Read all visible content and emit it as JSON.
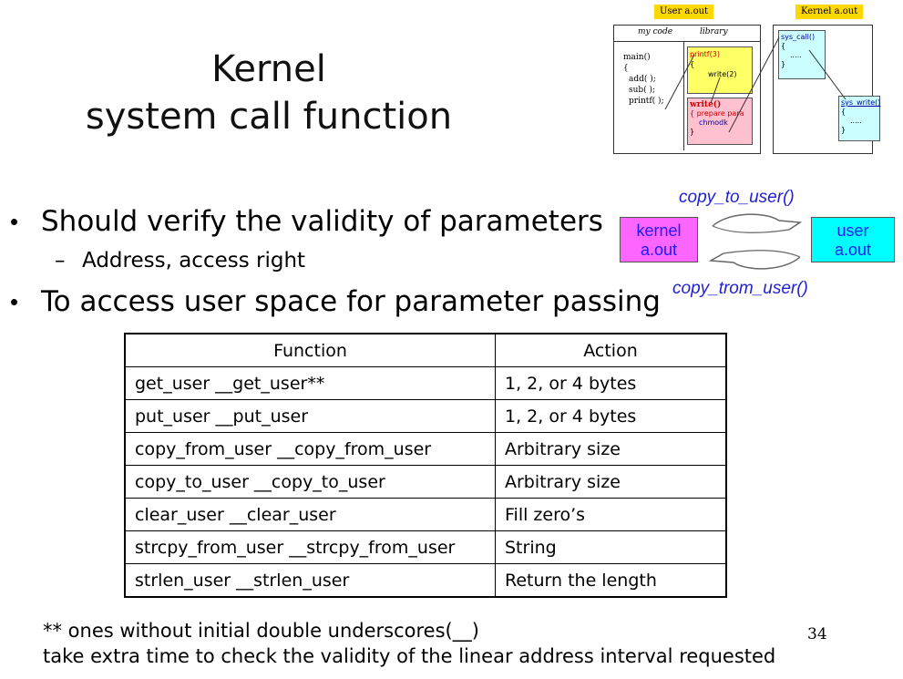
{
  "title": {
    "line1": "Kernel",
    "line2": "system call function"
  },
  "schematic": {
    "user_tag": "User   a.out",
    "kernel_tag": "Kernel   a.out",
    "col_mycode": "my code",
    "col_library": "library",
    "code_lines": [
      "main()",
      "{",
      "add( );",
      "sub( );",
      "printf( );"
    ],
    "printf_box": [
      "printf(3)",
      "{",
      "write(2)"
    ],
    "write_box": [
      "write()",
      "{ prepare para",
      "chmodk",
      "}"
    ],
    "kernel_box": [
      "sys_call()",
      "{",
      ".....",
      "}"
    ],
    "syswrite_box": [
      "sys_write()",
      "{",
      ".....",
      "}"
    ]
  },
  "bullets": {
    "b1": "Should verify the validity of parameters",
    "b1_sub": "Address, access right",
    "b2": "To access user space for parameter passing"
  },
  "copy_diagram": {
    "top_label": "copy_to_user()",
    "bottom_label": "copy_trom_user()",
    "kernel_line1": "kernel",
    "kernel_line2": "a.out",
    "user_line1": "user",
    "user_line2": "a.out",
    "kernel_color": "#ff66ff",
    "user_color": "#00ffff"
  },
  "table": {
    "headers": [
      "Function",
      "Action"
    ],
    "rows": [
      [
        "get_user __get_user**",
        "1, 2, or 4 bytes"
      ],
      [
        "put_user __put_user",
        "1, 2, or 4 bytes"
      ],
      [
        "copy_from_user __copy_from_user",
        "Arbitrary size"
      ],
      [
        "copy_to_user __copy_to_user",
        "Arbitrary size"
      ],
      [
        "clear_user __clear_user",
        "Fill zero’s"
      ],
      [
        "strcpy_from_user __strcpy_from_user",
        "String"
      ],
      [
        "strlen_user  __strlen_user",
        "Return the length"
      ]
    ]
  },
  "footnote": {
    "line1": "** ones without initial double underscores(__)",
    "line2": "take extra time to check the validity of the linear address interval requested"
  },
  "page_number": "34"
}
